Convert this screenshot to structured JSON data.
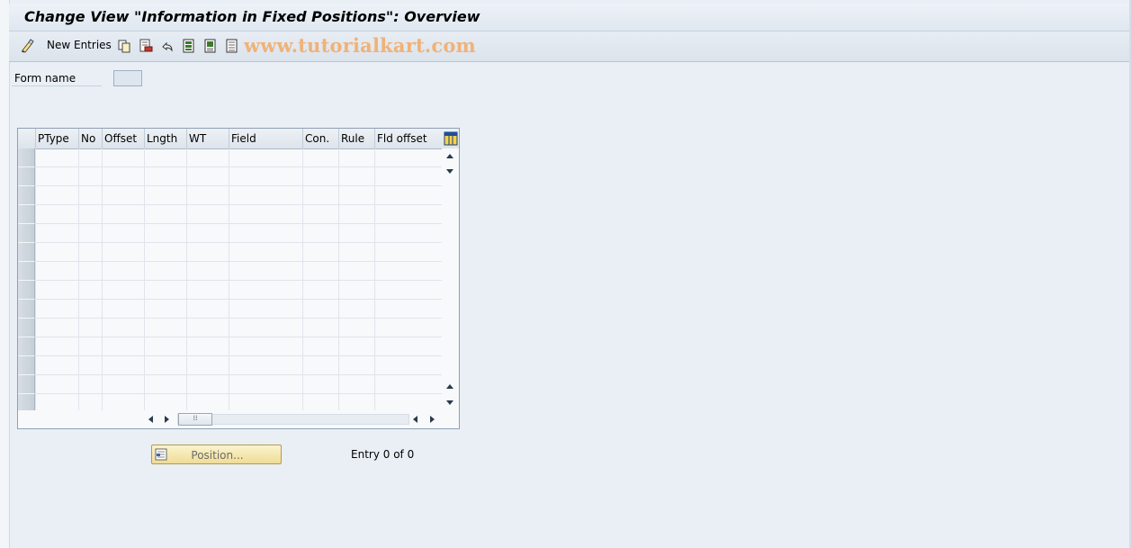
{
  "window": {
    "title": "Change View \"Information in Fixed Positions\": Overview"
  },
  "toolbar": {
    "new_entries_label": "New Entries",
    "icons": [
      "toggle-edit-icon",
      "copy-icon",
      "delete-icon",
      "undo-icon",
      "select-all-icon",
      "select-block-icon",
      "deselect-all-icon"
    ]
  },
  "watermark": "www.tutorialkart.com",
  "form": {
    "form_name_label": "Form name",
    "form_name_value": ""
  },
  "table": {
    "columns": [
      "PType",
      "No",
      "Offset",
      "Lngth",
      "WT",
      "Field",
      "Con.",
      "Rule",
      "Fld offset"
    ],
    "rows": []
  },
  "footer": {
    "position_button_label": "Position...",
    "entry_text": "Entry 0 of 0"
  },
  "colors": {
    "background": "#e9eff5",
    "button_bg": "#efdc95",
    "watermark": "#f0b278"
  }
}
